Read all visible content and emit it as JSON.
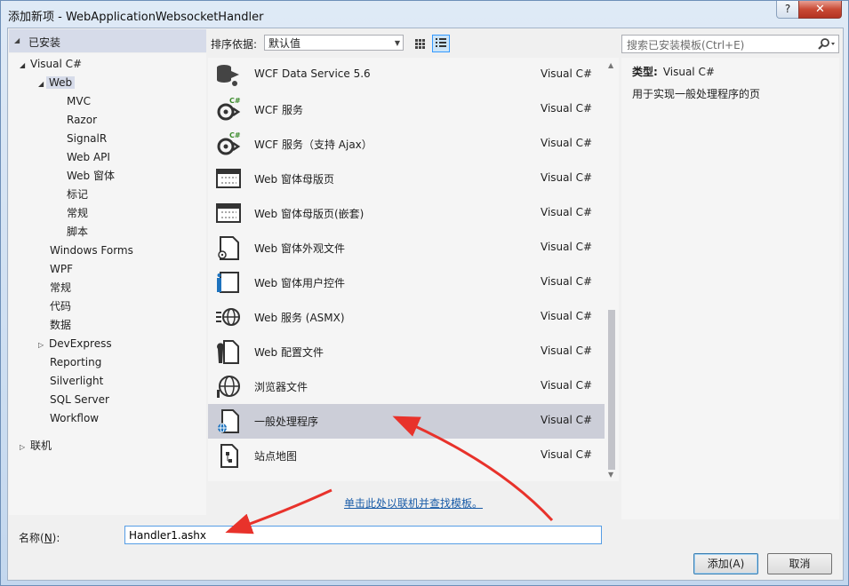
{
  "window": {
    "title": "添加新项 - WebApplicationWebsocketHandler",
    "help_label": "?",
    "close_label": "✕"
  },
  "sidebar": {
    "header": "已安装",
    "tree": [
      {
        "label": "Visual C#",
        "arrow": "◢"
      },
      {
        "label": "Web",
        "arrow": "◢"
      },
      {
        "label": "MVC"
      },
      {
        "label": "Razor"
      },
      {
        "label": "SignalR"
      },
      {
        "label": "Web API"
      },
      {
        "label": "Web 窗体"
      },
      {
        "label": "标记"
      },
      {
        "label": "常规"
      },
      {
        "label": "脚本"
      },
      {
        "label": "Windows Forms"
      },
      {
        "label": "WPF"
      },
      {
        "label": "常规"
      },
      {
        "label": "代码"
      },
      {
        "label": "数据"
      },
      {
        "label": "DevExpress",
        "arrow": "▷"
      },
      {
        "label": "Reporting"
      },
      {
        "label": "Silverlight"
      },
      {
        "label": "SQL Server"
      },
      {
        "label": "Workflow"
      },
      {
        "label": "联机",
        "arrow": "▷"
      }
    ]
  },
  "toolbar": {
    "sort_label": "排序依据:",
    "sort_value": "默认值"
  },
  "templates": [
    {
      "name": "WCF Data Service 5.6",
      "lang": "Visual C#",
      "icon": "data-service-icon"
    },
    {
      "name": "WCF 服务",
      "lang": "Visual C#",
      "icon": "wcf-service-icon"
    },
    {
      "name": "WCF 服务（支持 Ajax）",
      "lang": "Visual C#",
      "icon": "wcf-service-icon"
    },
    {
      "name": "Web 窗体母版页",
      "lang": "Visual C#",
      "icon": "master-page-icon"
    },
    {
      "name": "Web 窗体母版页(嵌套)",
      "lang": "Visual C#",
      "icon": "master-page-icon"
    },
    {
      "name": "Web 窗体外观文件",
      "lang": "Visual C#",
      "icon": "skin-file-icon"
    },
    {
      "name": "Web 窗体用户控件",
      "lang": "Visual C#",
      "icon": "user-control-icon"
    },
    {
      "name": "Web 服务 (ASMX)",
      "lang": "Visual C#",
      "icon": "web-service-icon"
    },
    {
      "name": "Web 配置文件",
      "lang": "Visual C#",
      "icon": "config-file-icon"
    },
    {
      "name": "浏览器文件",
      "lang": "Visual C#",
      "icon": "browser-file-icon"
    },
    {
      "name": "一般处理程序",
      "lang": "Visual C#",
      "icon": "generic-handler-icon"
    },
    {
      "name": "站点地图",
      "lang": "Visual C#",
      "icon": "sitemap-icon"
    }
  ],
  "search": {
    "placeholder": "搜索已安装模板(Ctrl+E)"
  },
  "details": {
    "type_label": "类型:",
    "type_value": "Visual C#",
    "description": "用于实现一般处理程序的页"
  },
  "online_link": "单击此处以联机并查找模板。",
  "name_field": {
    "label_prefix": "名称(",
    "label_key": "N",
    "label_suffix": "):",
    "value": "Handler1.ashx"
  },
  "buttons": {
    "add": "添加(A)",
    "cancel": "取消"
  },
  "colors": {
    "selection": "#ccced8",
    "link": "#1a5ca8",
    "arrow": "#e8322b"
  }
}
